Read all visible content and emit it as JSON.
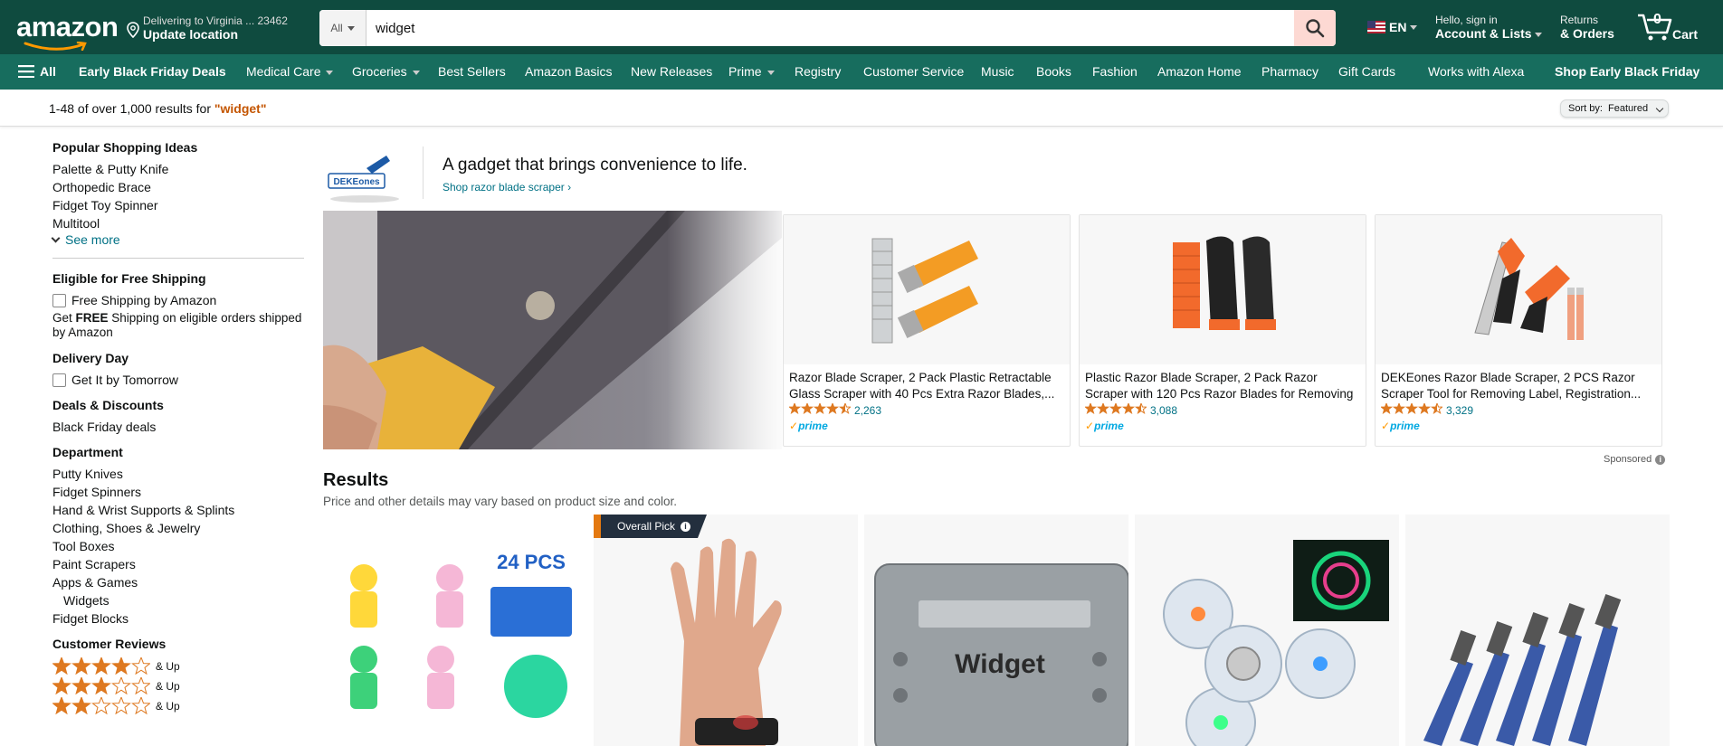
{
  "header": {
    "logo": "amazon",
    "deliver_line1": "Delivering to Virginia ... 23462",
    "deliver_line2": "Update location",
    "search_category": "All",
    "search_value": "widget",
    "lang": "EN",
    "account_line1": "Hello, sign in",
    "account_line2": "Account & Lists",
    "returns_line1": "Returns",
    "returns_line2": "& Orders",
    "cart_count": "0",
    "cart_label": "Cart"
  },
  "nav": {
    "all": "All",
    "items": [
      "Early Black Friday Deals",
      "Medical Care",
      "Groceries",
      "Best Sellers",
      "Amazon Basics",
      "New Releases",
      "Prime",
      "Registry",
      "Customer Service",
      "Music",
      "Books",
      "Fashion",
      "Amazon Home",
      "Pharmacy",
      "Gift Cards",
      "Works with Alexa",
      "Shop Early Black Friday"
    ]
  },
  "results_bar": {
    "prefix": "1-48 of over 1,000 results for ",
    "query": "\"widget\"",
    "sort_label": "Sort by:",
    "sort_value": "Featured"
  },
  "filters": {
    "popular_heading": "Popular Shopping Ideas",
    "popular": [
      "Palette & Putty Knife",
      "Orthopedic Brace",
      "Fidget Toy Spinner",
      "Multitool"
    ],
    "see_more": "See more",
    "shipping_heading": "Eligible for Free Shipping",
    "shipping_option": "Free Shipping by Amazon",
    "shipping_note_bold": "FREE",
    "shipping_note_pre": "Get ",
    "shipping_note_post": " Shipping on eligible orders shipped by Amazon",
    "delivery_heading": "Delivery Day",
    "delivery_option": "Get It by Tomorrow",
    "deals_heading": "Deals & Discounts",
    "deals_item": "Black Friday deals",
    "department_heading": "Department",
    "departments": [
      "Putty Knives",
      "Fidget Spinners",
      "Hand & Wrist Supports & Splints",
      "Clothing, Shoes & Jewelry",
      "Tool Boxes",
      "Paint Scrapers",
      "Apps & Games"
    ],
    "dept_sub": "Widgets",
    "dept_last": "Fidget Blocks",
    "reviews_heading": "Customer Reviews",
    "reviews_suffix": "& Up",
    "review_levels": [
      4,
      3,
      2
    ]
  },
  "sponsored": {
    "brand_logo": "DEKEones",
    "title": "A gadget that brings convenience to life.",
    "link": "Shop razor blade scraper ›",
    "products": [
      {
        "title": "Razor Blade Scraper, 2 Pack Plastic Retractable Glass Scraper with 40 Pcs Extra Razor Blades,...",
        "reviews": "2,263",
        "rating": 4.5
      },
      {
        "title": "Plastic Razor Blade Scraper, 2 Pack Razor Scraper with 120 Pcs Razor Blades for Removing Glue,...",
        "reviews": "3,088",
        "rating": 4.5
      },
      {
        "title": "DEKEones Razor Blade Scraper, 2 PCS Razor Scraper Tool for Removing Label, Registration...",
        "reviews": "3,329",
        "rating": 4.5
      }
    ],
    "prime": "prime",
    "label": "Sponsored"
  },
  "results": {
    "heading": "Results",
    "subtext": "Price and other details may vary based on product size and color.",
    "overall_pick": "Overall Pick",
    "item1_text": "24 PCS",
    "item3_text": "Widget"
  },
  "colors": {
    "header_bg": "#0f4b3f",
    "nav_bg": "#176d5e",
    "search_btn": "#fdd9d3",
    "link": "#007185",
    "star": "#de7921"
  }
}
